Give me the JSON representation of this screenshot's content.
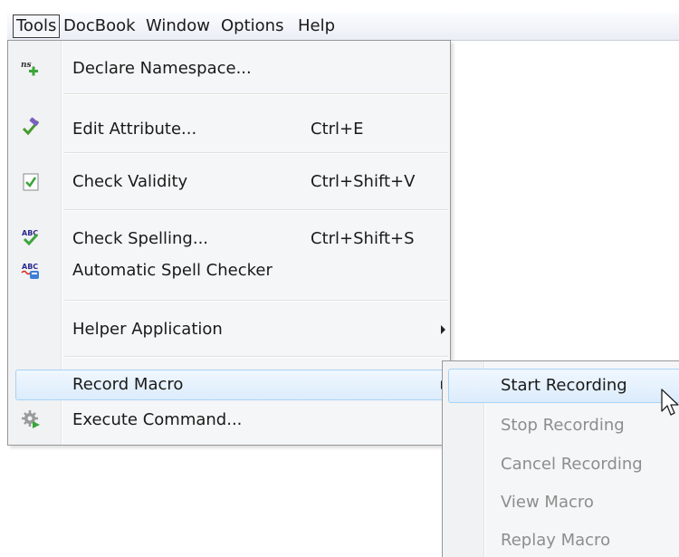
{
  "menubar": {
    "items": [
      "Tools",
      "DocBook",
      "Window",
      "Options",
      "Help"
    ],
    "open_item": "Tools"
  },
  "tools_menu": {
    "items": [
      {
        "label": "Declare Namespace...",
        "shortcut": "",
        "icon": "namespace-add-icon",
        "submenu": false
      },
      {
        "label": "Edit Attribute...",
        "shortcut": "Ctrl+E",
        "icon": "edit-attribute-icon",
        "submenu": false
      },
      {
        "label": "Check Validity",
        "shortcut": "Ctrl+Shift+V",
        "icon": "check-validity-icon",
        "submenu": false
      },
      {
        "label": "Check Spelling...",
        "shortcut": "Ctrl+Shift+S",
        "icon": "spell-check-icon",
        "submenu": false
      },
      {
        "label": "Automatic Spell Checker",
        "shortcut": "",
        "icon": "auto-spell-check-icon",
        "submenu": false
      },
      {
        "label": "Helper Application",
        "shortcut": "",
        "icon": "",
        "submenu": true
      },
      {
        "label": "Record Macro",
        "shortcut": "",
        "icon": "",
        "submenu": true,
        "highlighted": true
      },
      {
        "label": "Execute Command...",
        "shortcut": "",
        "icon": "execute-command-icon",
        "submenu": false
      }
    ]
  },
  "record_macro_submenu": {
    "items": [
      {
        "label": "Start Recording",
        "enabled": true,
        "highlighted": true
      },
      {
        "label": "Stop Recording",
        "enabled": false
      },
      {
        "label": "Cancel Recording",
        "enabled": false
      },
      {
        "label": "View Macro",
        "enabled": false
      },
      {
        "label": "Replay Macro",
        "enabled": false
      }
    ]
  },
  "colors": {
    "highlight_border": "#a8d3f7",
    "highlight_fill": "#dcecfc",
    "disabled_text": "#8d8d8d",
    "menu_bg": "#f5f6f7"
  }
}
